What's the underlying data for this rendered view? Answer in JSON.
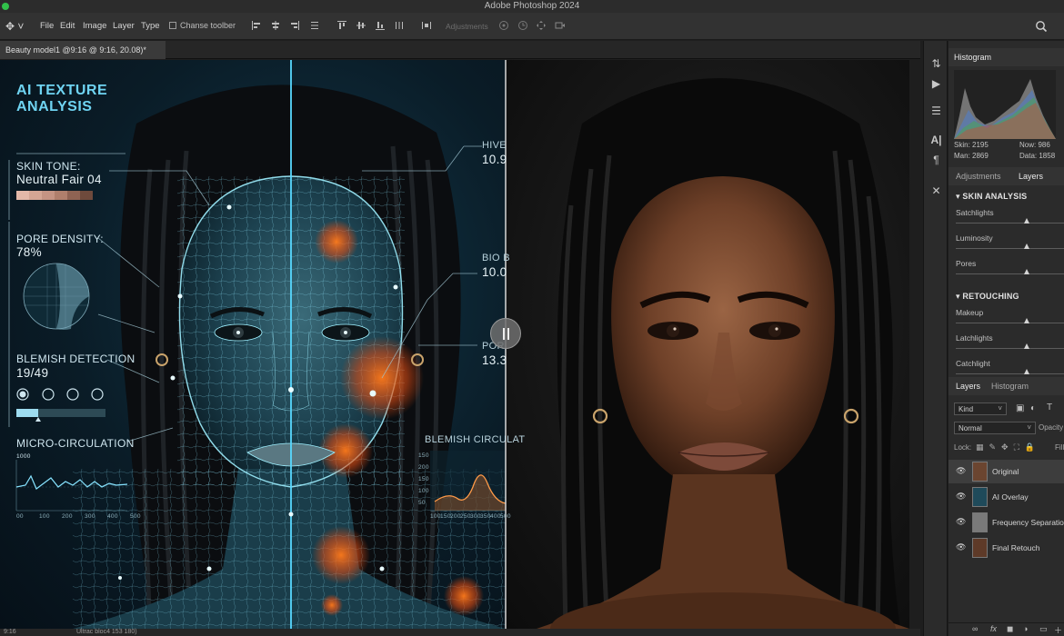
{
  "window": {
    "title": "Adobe Photoshop 2024"
  },
  "menu": {
    "items": [
      "File",
      "Edit",
      "Image",
      "Layer",
      "Type"
    ],
    "chrome_toolbar": "Chanse toolber",
    "adjustments": "Adjustments"
  },
  "document": {
    "tab_title": "Beauty model1 @9:16 @ 9:16, 20.08)*"
  },
  "overlay": {
    "title": "AI TEXTURE\nANALYSIS",
    "skin_tone_label": "SKIN TONE:",
    "skin_tone_value": "Neutral Fair 04",
    "pore_density_label": "PORE DENSITY:",
    "pore_density_value": "78%",
    "blemish_label": "BLEMISH DETECTION",
    "blemish_value": "19/49",
    "micro_label": "MICRO-CIRCULATION",
    "micro_axis_top": "1000",
    "micro_ticks": [
      "00",
      "100",
      "200",
      "300",
      "400",
      "500"
    ],
    "right_label_1": "HIVE",
    "right_value_1": "10.9",
    "right_label_2": "BIO B",
    "right_value_2": "10.0",
    "right_label_3": "POR",
    "right_value_3": "13.3",
    "blemish_circ_label": "BLEMISH CIRCULAT",
    "bc_yticks": [
      "150",
      "200",
      "150",
      "100",
      "50"
    ],
    "bc_xticks": [
      "100",
      "150",
      "200",
      "250",
      "300",
      "350",
      "400",
      "500"
    ],
    "skin_swatches": [
      "#e3b8a8",
      "#d4a694",
      "#c59483",
      "#b07f6c",
      "#8f6353",
      "#6e4a3c"
    ]
  },
  "status": {
    "zoom": "9:16",
    "info": "Ultrac bloc4 153 180)"
  },
  "histogram": {
    "tab": "Histogram",
    "stats": {
      "skin": "Skin: 2195",
      "now": "Now: 986",
      "man": "Man: 2869",
      "data": "Data: 1858"
    }
  },
  "adjustments_panel": {
    "tabs": [
      "Adjustments",
      "Layers"
    ],
    "sections": [
      {
        "title": "SKIN ANALYSIS",
        "sliders": [
          {
            "label": "Satchlights",
            "value": 0.6
          },
          {
            "label": "Luminosity",
            "value": 0.6
          },
          {
            "label": "Pores",
            "value": 0.6
          }
        ]
      },
      {
        "title": "RETOUCHING",
        "sliders": [
          {
            "label": "Makeup",
            "value": 0.6
          },
          {
            "label": "Latchlights",
            "value": 0.6
          },
          {
            "label": "Catchlight",
            "value": 0.6
          }
        ]
      }
    ]
  },
  "layers_panel": {
    "tabs": [
      "Layers",
      "Histogram"
    ],
    "kind": "Kind",
    "blend_mode": "Normal",
    "opacity_label": "Opacity",
    "lock_label": "Lock:",
    "fill_label": "Fill",
    "layers": [
      {
        "name": "Original"
      },
      {
        "name": "AI Overlay"
      },
      {
        "name": "Frequency Separation"
      },
      {
        "name": "Final Retouch"
      }
    ]
  }
}
